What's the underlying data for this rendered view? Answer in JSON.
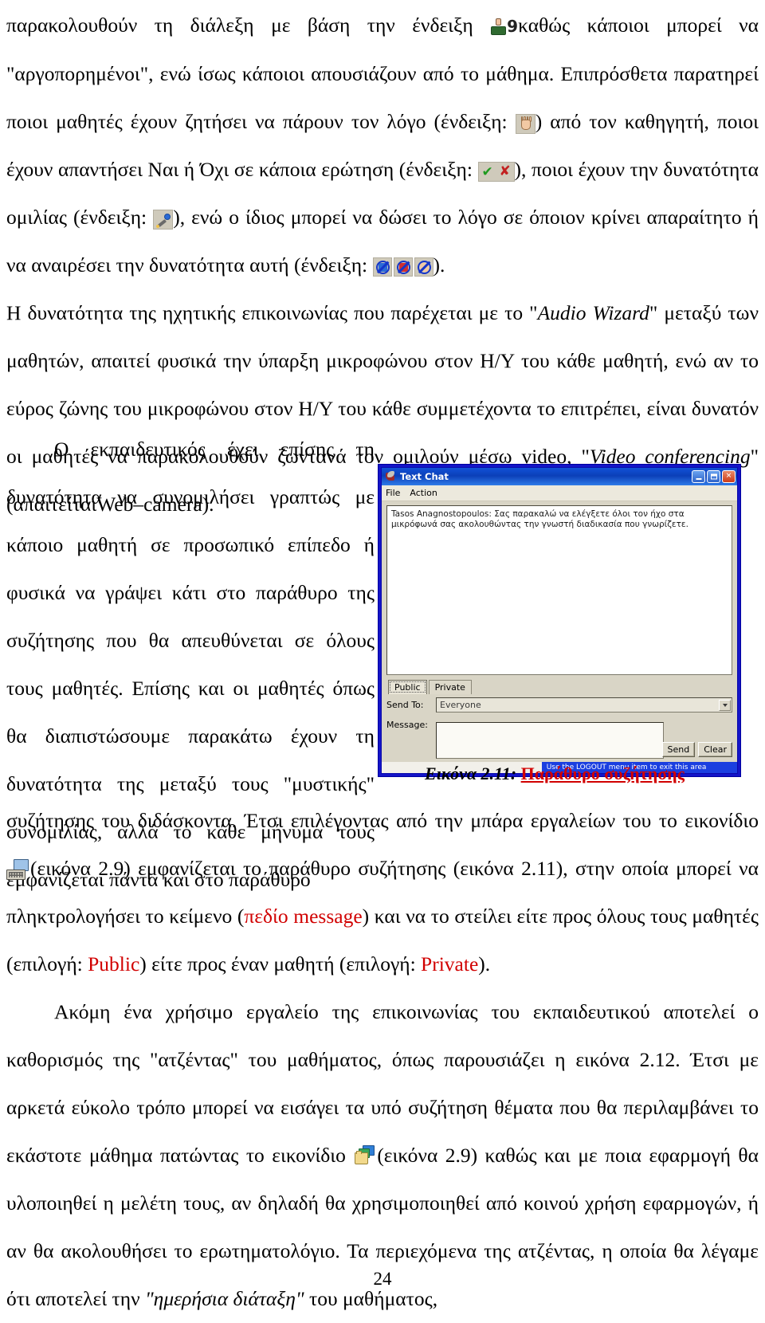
{
  "page": {
    "number": "24"
  },
  "paragraphs": {
    "p1_a": "παρακολουθούν τη διάλεξη με βάση την ένδειξη",
    "p1_b": "καθώς κάποιοι μπορεί να \"αργοπορημένοι\", ενώ ίσως κάποιοι απουσιάζουν από το μάθημα. Επιπρόσθετα παρατηρεί ποιοι μαθητές έχουν ζητήσει να πάρουν τον λόγο (ένδειξη:",
    "p1_c": ") από τον καθηγητή, ποιοι έχουν απαντήσει Ναι ή Όχι σε κάποια  ερώτηση (ένδειξη:",
    "p1_d": "), ποιοι έχουν την δυνατότητα ομιλίας (ένδειξη:",
    "p1_e": "), ενώ ο ίδιος μπορεί να δώσει το λόγο σε όποιον κρίνει απαραίτητο ή να αναιρέσει την δυνατότητα αυτή (ένδειξη:",
    "p1_f": ").",
    "p2": "Η δυνατότητα της ηχητικής επικοινωνίας  που παρέχεται με το \"Audio Wizard\" μεταξύ των μαθητών, απαιτεί φυσικά την ύπαρξη μικροφώνου στον Η/Υ του κάθε μαθητή, ενώ αν το εύρος ζώνης του μικροφώνου στον Η/Υ του κάθε συμμετέχοντα το επιτρέπει, είναι δυνατόν οι  μαθητές να παρακολουθούν ζωντανά τον ομιλούν μέσω video, \"Video conferencing\" (απαιτείταιWeb–camera).",
    "p2_em1": "Audio Wizard",
    "p2_em2": "Video conferencing",
    "p3": "Ο εκπαιδευτικός έχει επίσης τη δυνατότητα να συνομιλήσει γραπτώς με κάποιο μαθητή σε προσωπικό επίπεδο  ή φυσικά να γράψει κάτι στο παράθυρο της συζήτησης που θα απευθύνεται σε όλους τους μαθητές. Επίσης και οι μαθητές όπως θα διαπιστώσουμε παρακάτω   έχουν τη δυνατότητα της μεταξύ τους \"μυστικής\" συνομιλίας, αλλά το κάθε μήνυμα τους εμφανίζεται πάντα και στο παράθυρο",
    "p4_a": "συζήτησης του διδάσκοντα. Έτσι επιλέγοντας  από την μπάρα εργαλείων του το εικονίδιο",
    "p4_b": "(εικόνα 2.9) εμφανίζεται το παράθυρο συζήτησης (εικόνα 2.11), στην οποία μπορεί να πληκτρολογήσει το κείμενο (",
    "p4_red1": "πεδίο message",
    "p4_c": ") και να το στείλει είτε προς όλους τους μαθητές (επιλογή: ",
    "p4_red2": "Public",
    "p4_d": ") είτε προς έναν μαθητή (επιλογή: ",
    "p4_red3": "Private",
    "p4_e": ").",
    "p5_a": "Ακόμη ένα χρήσιμο εργαλείο της επικοινωνίας του εκπαιδευτικού αποτελεί ο καθορισμός της \"ατζέντας\" του μαθήματος, όπως παρουσιάζει η εικόνα 2.12. Έτσι με αρκετά εύκολο τρόπο μπορεί να εισάγει τα υπό συζήτηση θέματα που θα περιλαμβάνει το εκάστοτε μάθημα πατώντας το εικονίδιο",
    "p5_b": "(εικόνα 2.9) καθώς και με ποια εφαρμογή θα υλοποιηθεί η μελέτη τους, αν δηλαδή θα χρησιμοποιηθεί από κοινού χρήση εφαρμογών, ή αν θα ακολουθήσει το ερωτηματολόγιο. Τα περιεχόμενα της ατζέντας, η οποία θα λέγαμε ότι  αποτελεί  την   ",
    "p5_em": "\"ημερήσια διάταξη\"",
    "p5_c": " του μαθήματος,"
  },
  "caption": {
    "number": "Εικόνα 2.11:",
    "name": "Παράθυρο συζήτησης"
  },
  "icons": {
    "person_count": "9",
    "hand": "raise-hand-icon",
    "yesno": "yes-no-icon",
    "mic": "microphone-icon",
    "three": "speech-control-icons",
    "keyboard": "chat-toolbar-icon",
    "folders": "agenda-toolbar-icon"
  },
  "chat_window": {
    "title": "Text Chat",
    "menu": [
      "File",
      "Action"
    ],
    "log": "Tasos Anagnostopoulos: Σας παρακαλώ να ελέγξετε όλοι τον ήχο στα μικρόφωνά σας ακολουθώντας την γνωστή διαδικασία που γνωρίζετε.",
    "tabs": [
      "Public",
      "Private"
    ],
    "active_tab": "Public",
    "send_to_label": "Send To:",
    "send_to_value": "Everyone",
    "message_label": "Message:",
    "message_value": "",
    "buttons": {
      "send": "Send",
      "clear": "Clear"
    },
    "titlebar_buttons": {
      "minimize": "_",
      "maximize": "□",
      "close": "✕"
    },
    "statusbar": "Use the LOGOUT menu item to exit this area"
  },
  "colors": {
    "accent_red": "#d10000",
    "titlebar_blue": "#0b3fb8",
    "window_frame": "#1414c8",
    "dialog_face": "#d9d5c6"
  }
}
